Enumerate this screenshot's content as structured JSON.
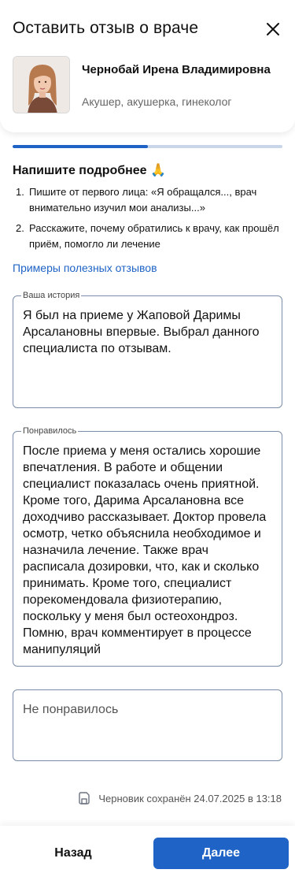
{
  "header": {
    "title": "Оставить отзыв о враче",
    "close_icon": "close-icon"
  },
  "doctor": {
    "name": "Чернобай Ирена Владимировна",
    "specialty": "Акушер, акушерка, гинеколог"
  },
  "progress": {
    "value": 0.5
  },
  "instructions": {
    "title": "Напишите подробнее 🙏",
    "tips": [
      {
        "num": "1.",
        "text": "Пишите от первого лица: «Я обращался..., врач внимательно изучил мои анализы...»"
      },
      {
        "num": "2.",
        "text": "Расскажите, почему обратились к врачу, как прошёл приём, помогло ли лечение"
      }
    ],
    "examples_link": "Примеры полезных отзывов"
  },
  "form": {
    "story": {
      "label": "Ваша история",
      "value": "Я был на приеме у Жаповой Даримы Арсалановны впервые. Выбрал данного специалиста по отзывам."
    },
    "liked": {
      "label": "Понравилось",
      "value": "После приема у меня остались хорошие впечатления. В работе и общении специалист показалась очень приятной. Кроме того, Дарима Арсалановна все доходчиво рассказывает. Доктор провела осмотр, четко объяснила необходимое и назначила лечение. Также врач расписала дозировки, что, как и сколько принимать. Кроме того, специалист порекомендовала физиотерапию, поскольку у меня был остеохондроз. Помню, врач комментирует в процессе манипуляций"
    },
    "disliked": {
      "placeholder": "Не понравилось",
      "value": ""
    }
  },
  "draft_status": "Черновик сохранён 24.07.2025 в 13:18",
  "footer": {
    "back_label": "Назад",
    "next_label": "Далее"
  },
  "colors": {
    "accent": "#1f63c6",
    "progress_track": "#c9d6e9",
    "field_border": "#7b8da8"
  }
}
